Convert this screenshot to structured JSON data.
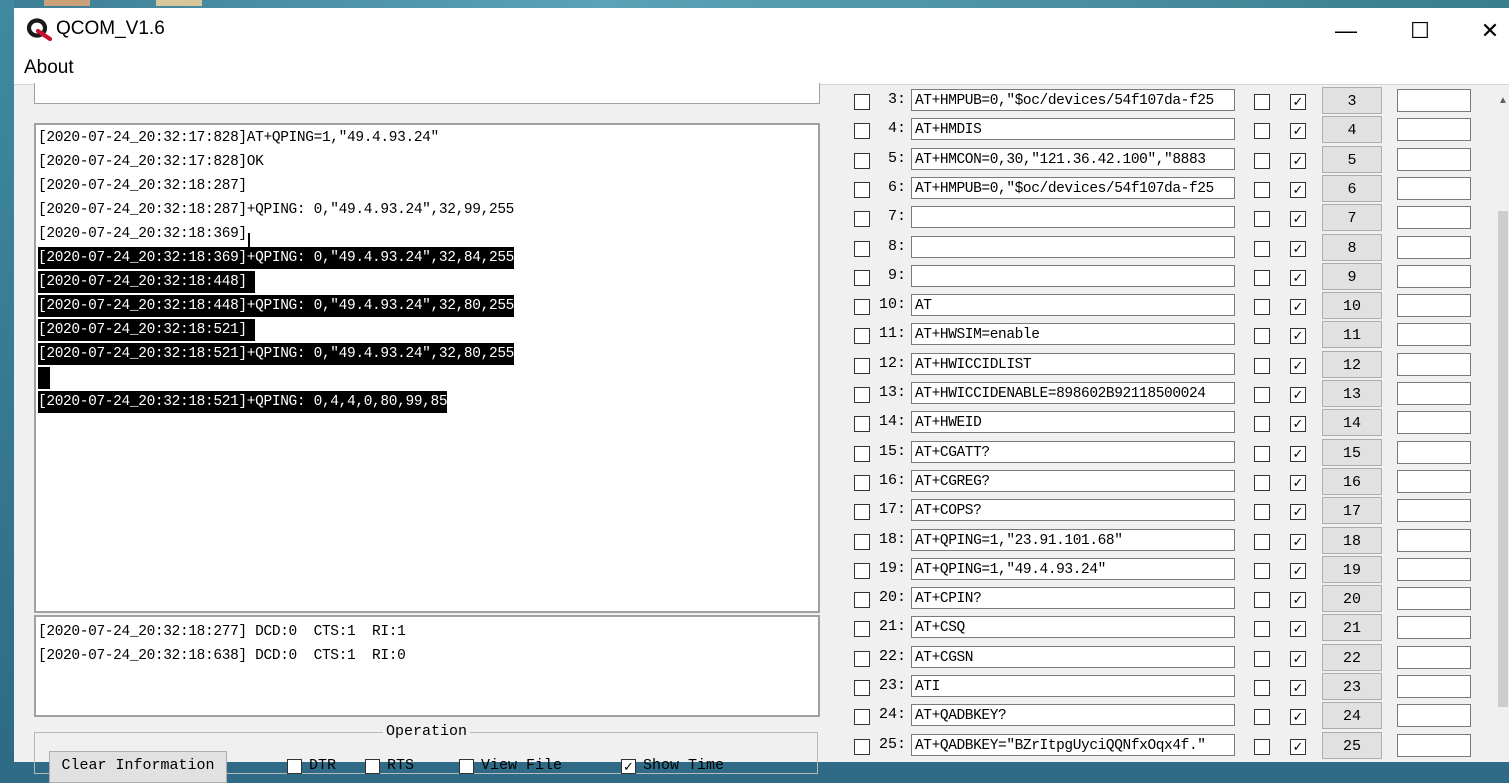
{
  "window": {
    "title": "QCOM_V1.6",
    "minimize": "—",
    "maximize": "☐",
    "close": "✕"
  },
  "menu": {
    "about": "About"
  },
  "receive_log": [
    {
      "text": "[2020-07-24_20:32:17:828]AT+QPING=1,\"49.4.93.24\"",
      "selected": false
    },
    {
      "text": "[2020-07-24_20:32:17:828]OK",
      "selected": false
    },
    {
      "text": "[2020-07-24_20:32:18:287]",
      "selected": false
    },
    {
      "text": "[2020-07-24_20:32:18:287]+QPING: 0,\"49.4.93.24\",32,99,255",
      "selected": false
    },
    {
      "text": "[2020-07-24_20:32:18:369]",
      "selected": false
    },
    {
      "text": "[2020-07-24_20:32:18:369]+QPING: 0,\"49.4.93.24\",32,84,255",
      "selected": true
    },
    {
      "text": "[2020-07-24_20:32:18:448]",
      "selected": true
    },
    {
      "text": "[2020-07-24_20:32:18:448]+QPING: 0,\"49.4.93.24\",32,80,255",
      "selected": true
    },
    {
      "text": "[2020-07-24_20:32:18:521]",
      "selected": true
    },
    {
      "text": "[2020-07-24_20:32:18:521]+QPING: 0,\"49.4.93.24\",32,80,255",
      "selected": true
    },
    {
      "text": "",
      "selected": true
    },
    {
      "text": "[2020-07-24_20:32:18:521]+QPING: 0,4,4,0,80,99,85",
      "selected": true
    }
  ],
  "status_log": [
    "[2020-07-24_20:32:18:277] DCD:0  CTS:1  RI:1",
    "[2020-07-24_20:32:18:638] DCD:0  CTS:1  RI:0"
  ],
  "operation": {
    "label": "Operation",
    "clear_button": "Clear Information",
    "dtr": "DTR",
    "rts": "RTS",
    "view_file": "View File",
    "show_time": "Show Time",
    "show_time_checked": true
  },
  "commands": [
    {
      "num": "3:",
      "cmd": "AT+HMPUB=0,\"$oc/devices/54f107da-f25",
      "btn": "3"
    },
    {
      "num": "4:",
      "cmd": "AT+HMDIS",
      "btn": "4"
    },
    {
      "num": "5:",
      "cmd": "AT+HMCON=0,30,\"121.36.42.100\",\"8883",
      "btn": "5"
    },
    {
      "num": "6:",
      "cmd": "AT+HMPUB=0,\"$oc/devices/54f107da-f25",
      "btn": "6"
    },
    {
      "num": "7:",
      "cmd": "",
      "btn": "7"
    },
    {
      "num": "8:",
      "cmd": "",
      "btn": "8"
    },
    {
      "num": "9:",
      "cmd": "",
      "btn": "9"
    },
    {
      "num": "10:",
      "cmd": "AT",
      "btn": "10"
    },
    {
      "num": "11:",
      "cmd": "AT+HWSIM=enable",
      "btn": "11"
    },
    {
      "num": "12:",
      "cmd": "AT+HWICCIDLIST",
      "btn": "12"
    },
    {
      "num": "13:",
      "cmd": "AT+HWICCIDENABLE=898602B92118500024",
      "btn": "13"
    },
    {
      "num": "14:",
      "cmd": "AT+HWEID",
      "btn": "14"
    },
    {
      "num": "15:",
      "cmd": "AT+CGATT?",
      "btn": "15"
    },
    {
      "num": "16:",
      "cmd": "AT+CGREG?",
      "btn": "16"
    },
    {
      "num": "17:",
      "cmd": "AT+COPS?",
      "btn": "17"
    },
    {
      "num": "18:",
      "cmd": "AT+QPING=1,\"23.91.101.68\"",
      "btn": "18"
    },
    {
      "num": "19:",
      "cmd": "AT+QPING=1,\"49.4.93.24\"",
      "btn": "19"
    },
    {
      "num": "20:",
      "cmd": "AT+CPIN?",
      "btn": "20"
    },
    {
      "num": "21:",
      "cmd": "AT+CSQ",
      "btn": "21"
    },
    {
      "num": "22:",
      "cmd": "AT+CGSN",
      "btn": "22"
    },
    {
      "num": "23:",
      "cmd": "ATI",
      "btn": "23"
    },
    {
      "num": "24:",
      "cmd": "AT+QADBKEY?",
      "btn": "24"
    },
    {
      "num": "25:",
      "cmd": "AT+QADBKEY=\"BZrItpgUyciQQNfxOqx4f.\"",
      "btn": "25"
    }
  ],
  "colors": {
    "selection_bg": "#000000",
    "selection_fg": "#ffffff",
    "logo_red": "#c8102e"
  }
}
